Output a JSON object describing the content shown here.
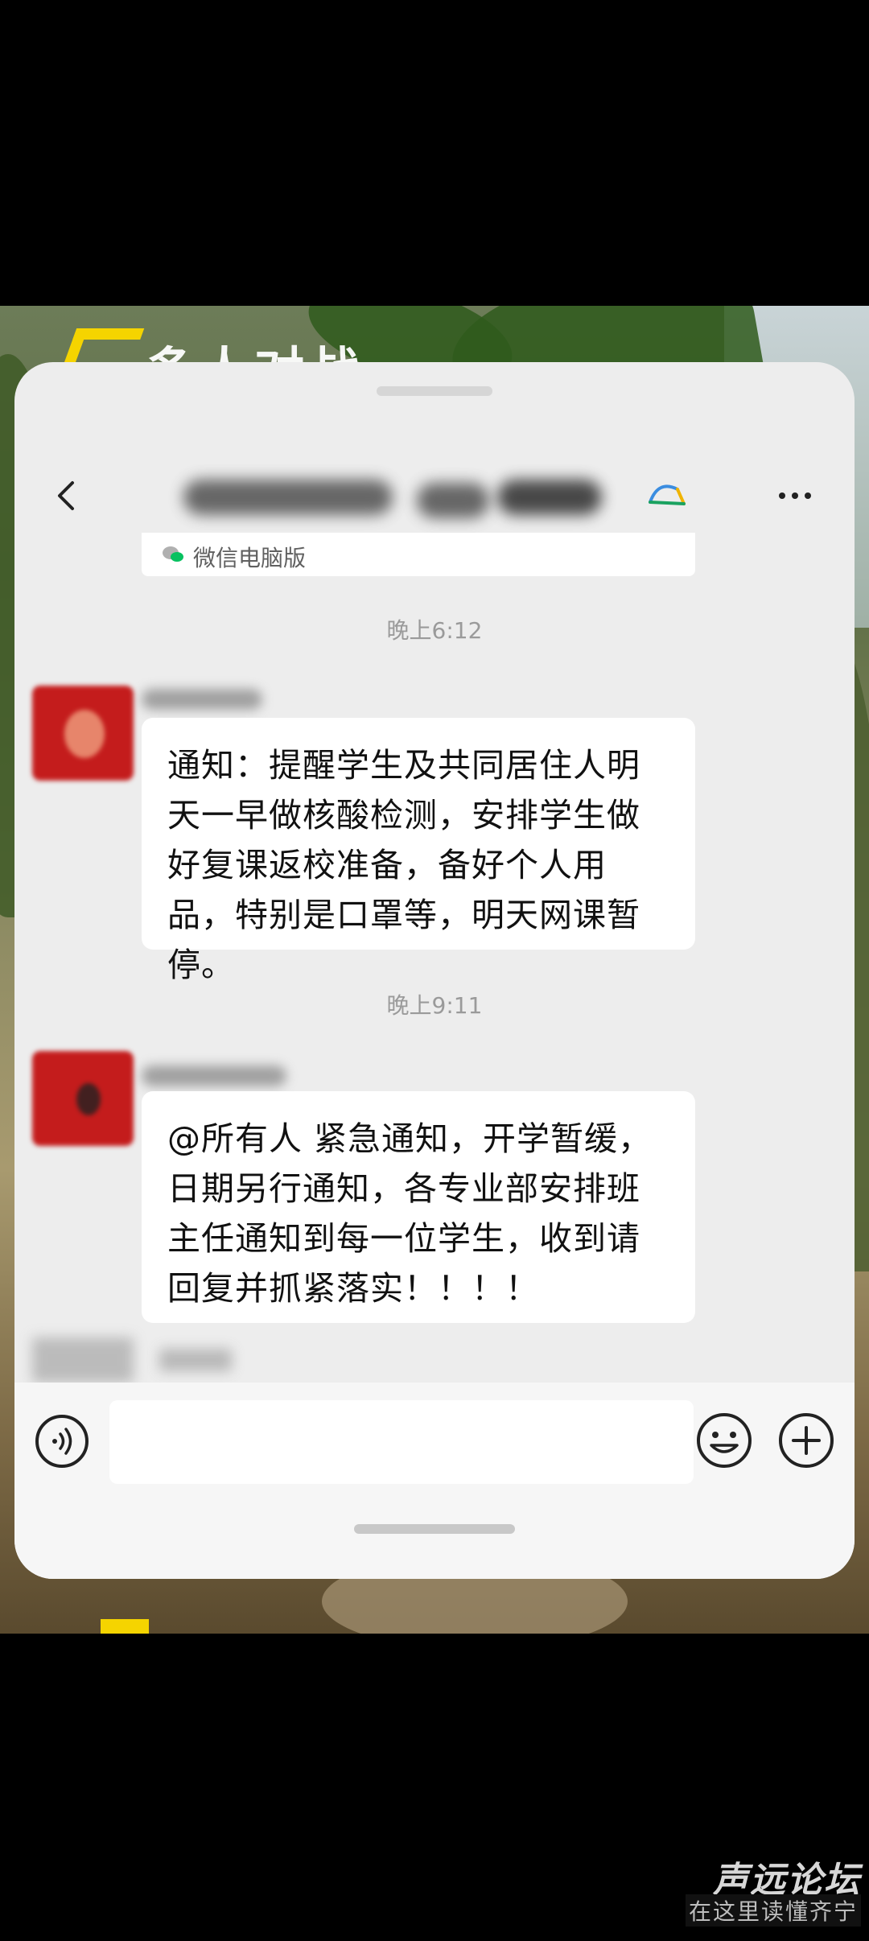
{
  "scene": {
    "game_title": "多人对战"
  },
  "chat": {
    "source_label": "微信电脑版",
    "messages": [
      {
        "time": "晚上6:12",
        "text": "通知：提醒学生及共同居住人明天一早做核酸检测，安排学生做好复课返校准备，备好个人用品，特别是口罩等，明天网课暂停。"
      },
      {
        "time": "晚上9:11",
        "text": "@所有人  紧急通知，开学暂缓，日期另行通知，各专业部安排班主任通知到每一位学生，收到请回复并抓紧落实！！！！"
      }
    ]
  },
  "icons": {
    "back": "back-arrow-icon",
    "group": "group-chat-icon",
    "more": "more-options-icon",
    "voice": "voice-input-icon",
    "emoji": "emoji-icon",
    "plus": "plus-icon"
  },
  "watermark": {
    "top": "声远论坛",
    "bottom": "在这里读懂齐宁"
  },
  "colors": {
    "accent_green": "#07c160",
    "bubble": "#ffffff",
    "window": "#ededed"
  }
}
